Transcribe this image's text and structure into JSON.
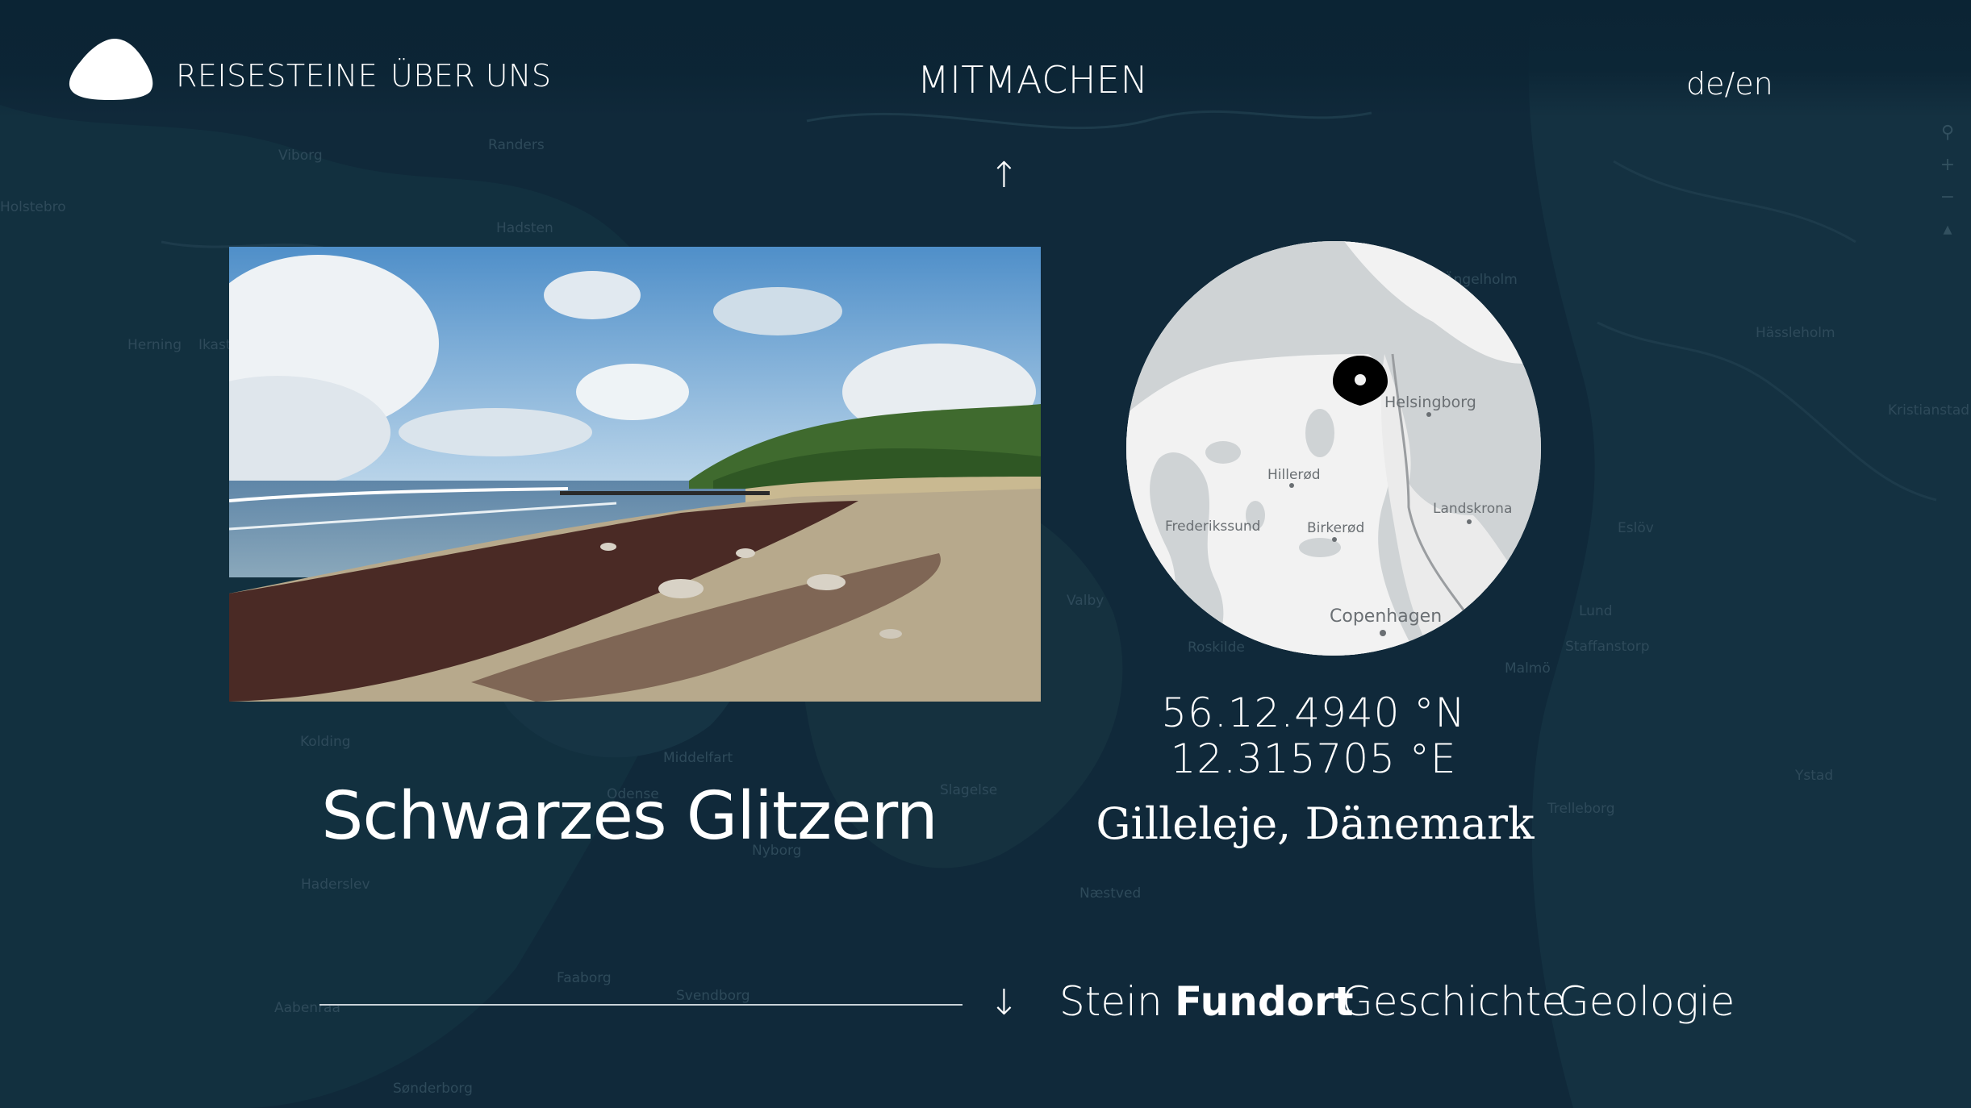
{
  "nav": {
    "reisesteine": "REISESTEINE",
    "ueber_uns": "ÜBER UNS",
    "mitmachen": "MITMACHEN",
    "language": "de/en"
  },
  "arrows": {
    "up": "↑",
    "down": "↓"
  },
  "stone": {
    "title": "Schwarzes Glitzern"
  },
  "location": {
    "latitude": "56.12.4940 °N",
    "longitude": "12.315705 °E",
    "place": "Gilleleje, Dänemark",
    "map_labels": {
      "helsingborg": "Helsingborg",
      "hilleroed": "Hillerød",
      "frederikssund": "Frederikssund",
      "birkeroed": "Birkerød",
      "landskrona": "Landskrona",
      "copenhagen": "Copenhagen"
    }
  },
  "tabs": {
    "stein": "Stein",
    "fundort": "Fundort",
    "geschichte": "Geschichte",
    "geologie": "Geologie",
    "active": "Fundort"
  },
  "background_map_labels": {
    "viborg": "Viborg",
    "randers": "Randers",
    "holstebro": "Holstebro",
    "hadsten": "Hadsten",
    "herning": "Herning",
    "ikast": "Ikast",
    "kolding": "Kolding",
    "middelfart": "Middelfart",
    "odense": "Odense",
    "nyborg": "Nyborg",
    "slagelse": "Slagelse",
    "haderslev": "Haderslev",
    "aabenraa": "Aabenraa",
    "faaborg": "Faaborg",
    "svendborg": "Svendborg",
    "naestved": "Næstved",
    "sonderborg": "Sønderborg",
    "roskilde": "Roskilde",
    "valby": "Valby",
    "malmoe": "Malmö",
    "lund": "Lund",
    "staffanstorp": "Staffanstorp",
    "trelleborg": "Trelleborg",
    "ystad": "Ystad",
    "angelholm": "Ängelholm",
    "hassleholm": "Hässleholm",
    "kristianstad": "Kristianstad",
    "eslov": "Eslöv"
  },
  "colors": {
    "background": "#10293a",
    "text": "#ffffff",
    "map_land": "#f2f2f2",
    "map_water": "#cfd3d5"
  }
}
